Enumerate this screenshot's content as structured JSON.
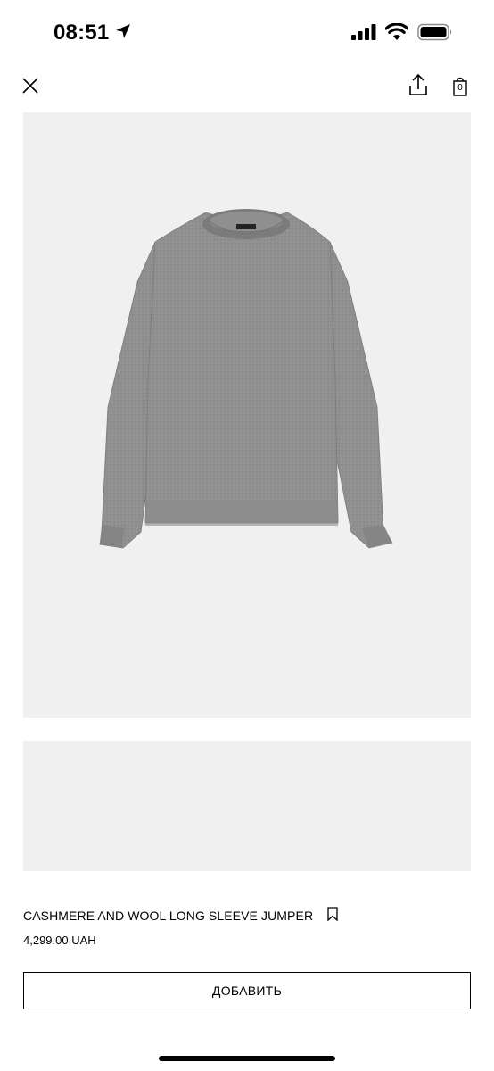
{
  "status_bar": {
    "time": "08:51",
    "icons": [
      "location-arrow-icon",
      "cellular-signal-icon",
      "wifi-icon",
      "battery-icon"
    ]
  },
  "nav": {
    "icons": [
      "close-icon",
      "share-icon",
      "shopping-bag-icon"
    ],
    "bag_count": "0"
  },
  "product": {
    "title": "CASHMERE AND WOOL LONG SLEEVE JUMPER",
    "price": "4,299.00 UAH",
    "image_subject": "grey knit jumper",
    "bookmark_icon": "bookmark-icon"
  },
  "actions": {
    "add_label": "ДОБАВИТЬ"
  },
  "colors": {
    "image_background": "#f0f0f0",
    "sweater": "#8c8c8c",
    "text": "#000000"
  }
}
